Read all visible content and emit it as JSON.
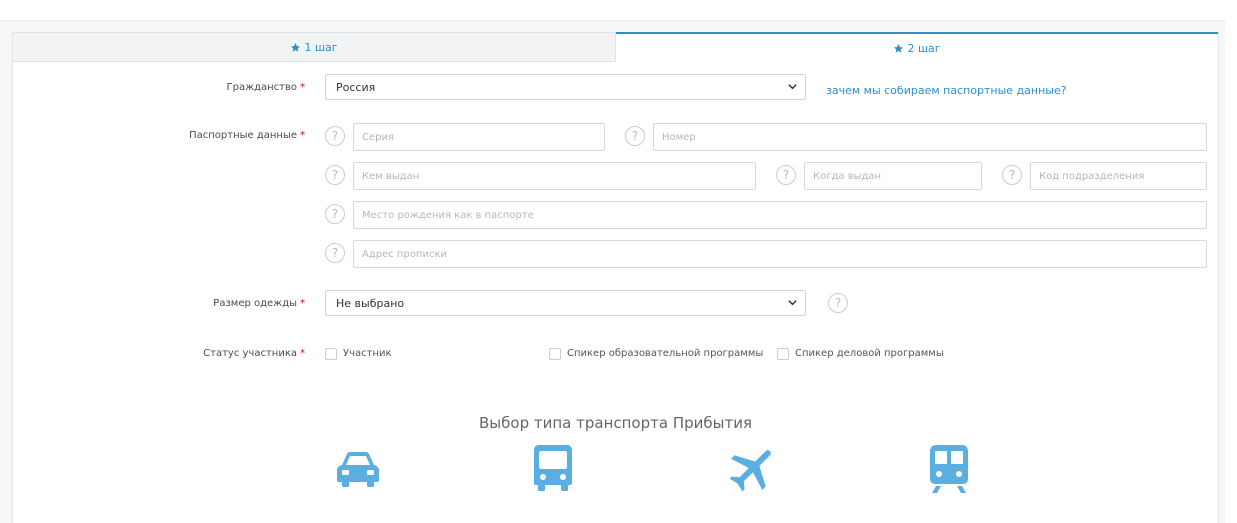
{
  "tabs": [
    {
      "label": "1 шаг"
    },
    {
      "label": "2 шаг"
    }
  ],
  "citizenship": {
    "label": "Гражданство",
    "value": "Россия",
    "link": "зачем мы собираем паспортные данные?"
  },
  "passport": {
    "label": "Паспортные данные",
    "series_placeholder": "Серия",
    "number_placeholder": "Номер",
    "issued_by_placeholder": "Кем выдан",
    "issued_date_placeholder": "Когда выдан",
    "division_code_placeholder": "Код подразделения",
    "birthplace_placeholder": "Место рождения как в паспорте",
    "address_placeholder": "Адрес прописки"
  },
  "help_glyph": "?",
  "required_mark": "*",
  "clothing": {
    "label": "Размер одежды",
    "value": "Не выбрано"
  },
  "status": {
    "label": "Статус участника",
    "options": [
      "Участник",
      "Спикер образовательной программы",
      "Спикер деловой программы"
    ]
  },
  "transport": {
    "title": "Выбор типа транспорта Прибытия",
    "icons": [
      "car-icon",
      "bus-icon",
      "airplane-icon",
      "train-icon"
    ],
    "color": "#5aaee0"
  },
  "accent_color": "#2d8fc6"
}
